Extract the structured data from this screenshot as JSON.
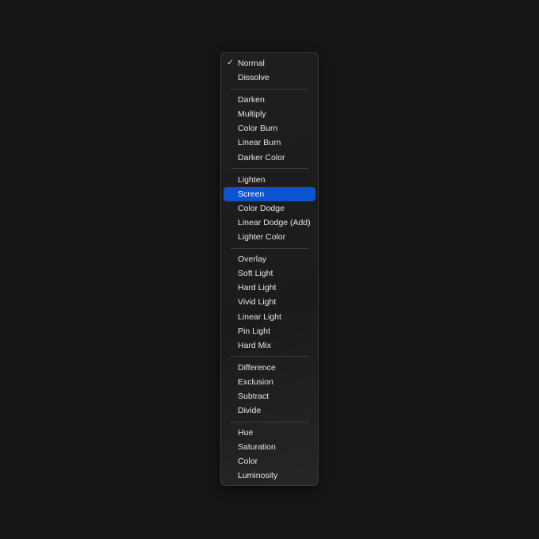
{
  "menu": {
    "checked_item": "Normal",
    "highlighted_item": "Screen",
    "highlight_color": "#0b54d0",
    "groups": [
      [
        "Normal",
        "Dissolve"
      ],
      [
        "Darken",
        "Multiply",
        "Color Burn",
        "Linear Burn",
        "Darker Color"
      ],
      [
        "Lighten",
        "Screen",
        "Color Dodge",
        "Linear Dodge (Add)",
        "Lighter Color"
      ],
      [
        "Overlay",
        "Soft Light",
        "Hard Light",
        "Vivid Light",
        "Linear Light",
        "Pin Light",
        "Hard Mix"
      ],
      [
        "Difference",
        "Exclusion",
        "Subtract",
        "Divide"
      ],
      [
        "Hue",
        "Saturation",
        "Color",
        "Luminosity"
      ]
    ],
    "check_glyph": "✓"
  }
}
